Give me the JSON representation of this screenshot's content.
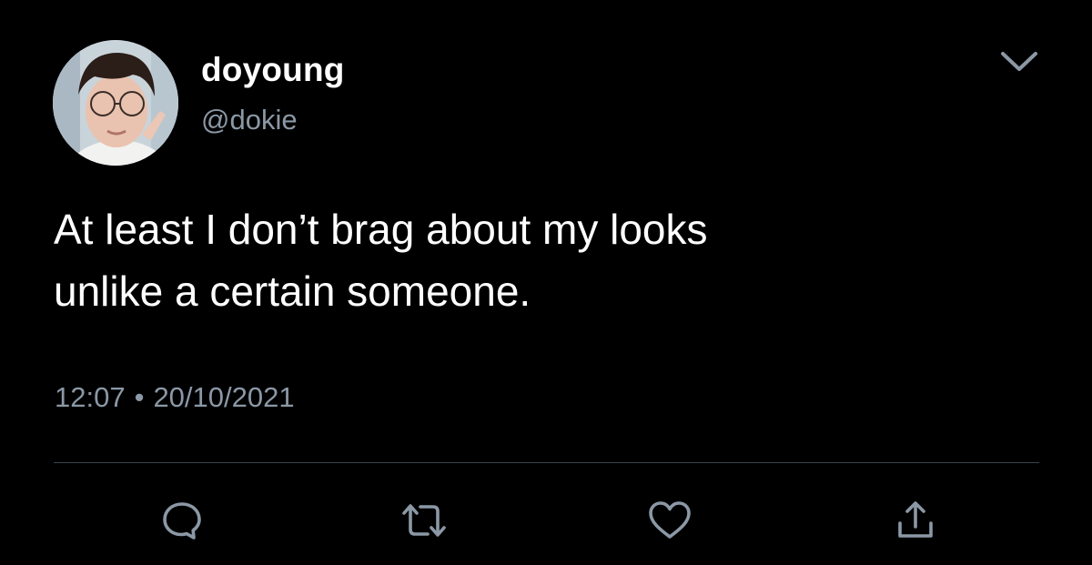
{
  "tweet": {
    "author": {
      "display_name": "doyoung",
      "handle": "@dokie"
    },
    "text": "At least I don’t brag about my looks\nunlike a certain someone.",
    "time": "12:07",
    "separator": "•",
    "date": "20/10/2021"
  },
  "icons": {
    "menu": "chevron-down-icon",
    "reply": "reply-bubble-icon",
    "retweet": "retweet-icon",
    "like": "heart-icon",
    "share": "share-upload-icon"
  },
  "colors": {
    "background": "#000000",
    "text_primary": "#ffffff",
    "text_secondary": "#8b98a5",
    "divider": "#38444d",
    "icon": "#8b98a5"
  }
}
